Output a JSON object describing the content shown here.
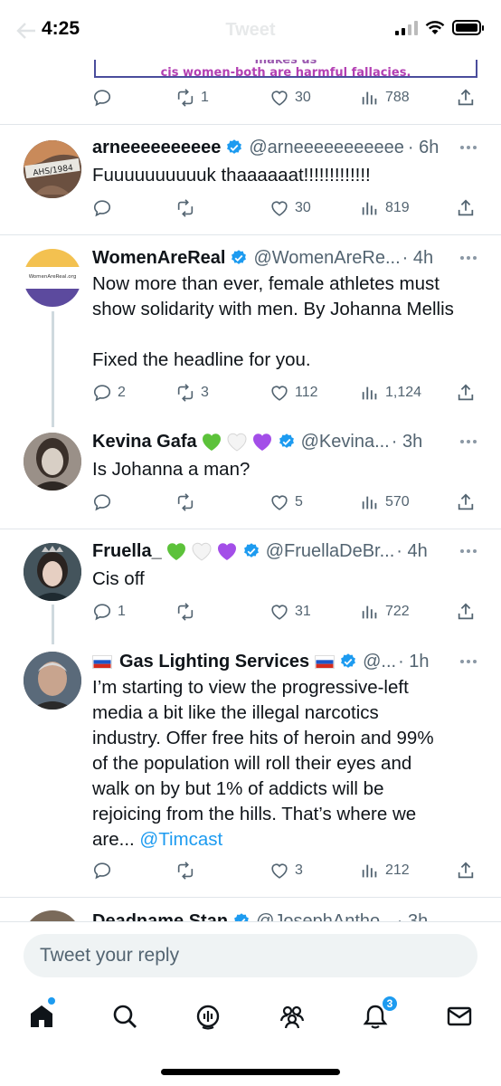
{
  "status_bar": {
    "time": "4:25",
    "title": "Tweet"
  },
  "quoted_image": {
    "line1": "matter how they present. Framing men as cis women makes us",
    "line2": "cis women-both are harmful  fallacies."
  },
  "top_actions": {
    "reply": "",
    "retweets": "1",
    "likes": "30",
    "views": "788"
  },
  "tweets": [
    {
      "name": "arneeeeeeeeee",
      "handle": "@arneeeeeeeeeee",
      "time": "· 6h",
      "body": "Fuuuuuuuuuuk thaaaaaat!!!!!!!!!!!!!",
      "replies": "",
      "retweets": "",
      "likes": "30",
      "views": "819"
    },
    {
      "name": "WomenAreReal",
      "handle": "@WomenAreRe...",
      "time": "· 4h",
      "avatar_text": "WomenAreReal.org",
      "body": "Now more than ever, female athletes must show solidarity with men. By Johanna Mellis\n\nFixed the headline for you.",
      "replies": "2",
      "retweets": "3",
      "likes": "112",
      "views": "1,124"
    },
    {
      "name": "Kevina Gafa",
      "handle": "@Kevina...",
      "time": "· 3h",
      "body": "Is Johanna a man?",
      "replies": "",
      "retweets": "",
      "likes": "5",
      "views": "570"
    },
    {
      "name": "Fruella_",
      "handle": "@FruellaDeBr...",
      "time": "· 4h",
      "body": "Cis off",
      "replies": "1",
      "retweets": "",
      "likes": "31",
      "views": "722"
    },
    {
      "name": "Gas Lighting Services",
      "handle": "@...",
      "time": "· 1h",
      "body": "I’m starting to view the progressive-left media a bit like the illegal narcotics industry. Offer free hits of heroin and 99% of the population will roll their eyes and walk on by but 1% of addicts will be rejoicing from the hills. That’s where we are... ",
      "mention": "@Timcast",
      "replies": "",
      "retweets": "",
      "likes": "3",
      "views": "212"
    },
    {
      "name": "Deadname Stan",
      "handle": "@JosephAntho...",
      "time": "· 3h"
    }
  ],
  "reply_box": {
    "placeholder": "Tweet your reply"
  },
  "tabbar": {
    "notifications_badge": "3"
  },
  "colors": {
    "accent": "#1d9bf0",
    "muted": "#536471",
    "purple": "#5c4a9e",
    "gold": "#f3c150"
  }
}
